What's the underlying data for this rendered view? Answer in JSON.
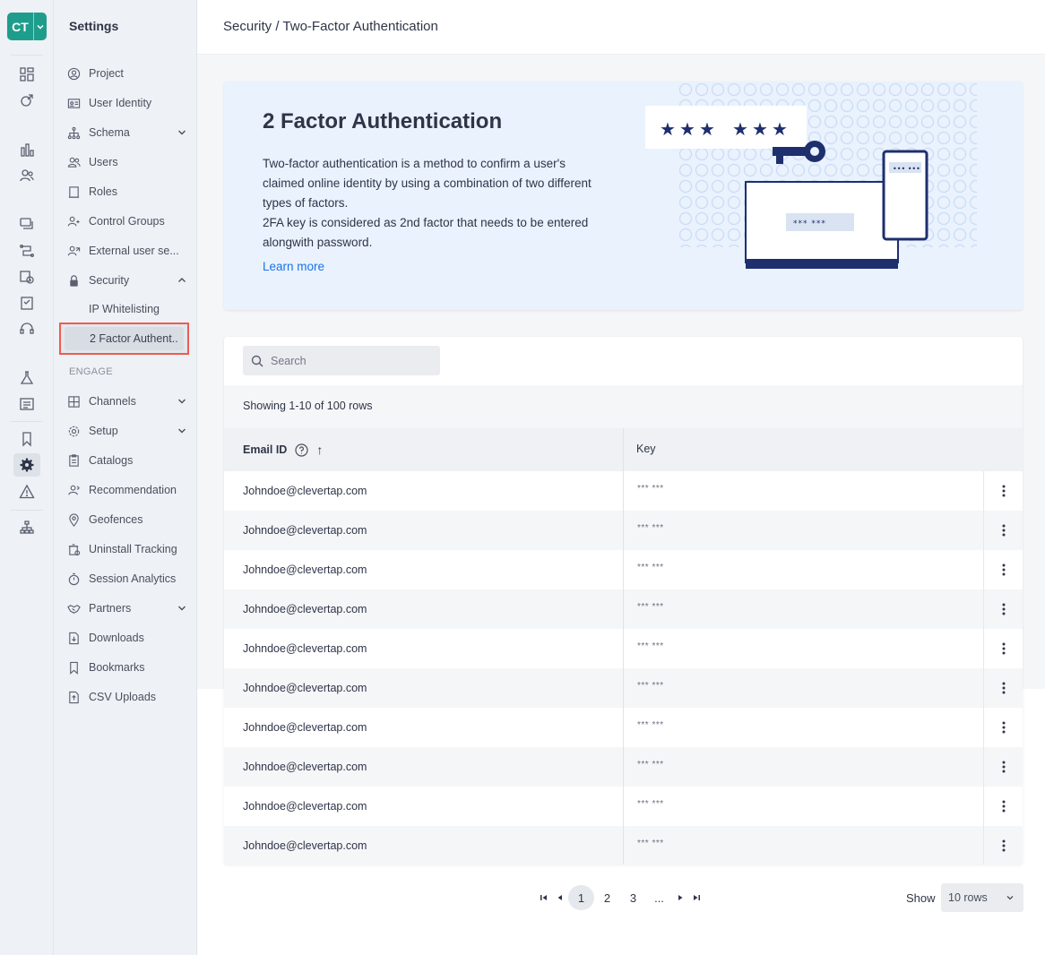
{
  "brand": {
    "logo_text": "CT"
  },
  "sidebar": {
    "title": "Settings",
    "items": [
      {
        "label": "Project",
        "icon": "project-icon"
      },
      {
        "label": "User Identity",
        "icon": "id-card-icon"
      },
      {
        "label": "Schema",
        "icon": "schema-icon",
        "expandable": true
      },
      {
        "label": "Users",
        "icon": "users-icon"
      },
      {
        "label": "Roles",
        "icon": "roles-icon"
      },
      {
        "label": "Control Groups",
        "icon": "control-groups-icon"
      },
      {
        "label": "External user se...",
        "icon": "external-users-icon"
      },
      {
        "label": "Security",
        "icon": "lock-icon",
        "expanded": true
      }
    ],
    "security_sub": [
      "IP Whitelisting",
      "2 Factor Authent.."
    ],
    "section_engage": "ENGAGE",
    "engage_items": [
      {
        "label": "Channels",
        "icon": "channels-icon",
        "expandable": true
      },
      {
        "label": "Setup",
        "icon": "gear-icon",
        "expandable": true
      },
      {
        "label": "Catalogs",
        "icon": "catalog-icon"
      },
      {
        "label": "Recommendation",
        "icon": "recommendation-icon"
      },
      {
        "label": "Geofences",
        "icon": "location-pin-icon"
      },
      {
        "label": "Uninstall Tracking",
        "icon": "uninstall-icon"
      },
      {
        "label": "Session Analytics",
        "icon": "stopwatch-icon"
      },
      {
        "label": "Partners",
        "icon": "handshake-icon",
        "expandable": true
      },
      {
        "label": "Downloads",
        "icon": "download-icon"
      },
      {
        "label": "Bookmarks",
        "icon": "bookmark-icon"
      },
      {
        "label": "CSV Uploads",
        "icon": "upload-icon"
      }
    ]
  },
  "header": {
    "breadcrumb": "Security / Two-Factor Authentication"
  },
  "banner": {
    "title": "2 Factor Authentication",
    "description_line1": "Two-factor authentication is a method to confirm a user's claimed online identity by using a combination of two different types of factors.",
    "description_line2": "2FA key is considered as 2nd factor that needs to be entered alongwith password.",
    "learn_more": "Learn more"
  },
  "table": {
    "search_placeholder": "Search",
    "showing_text": "Showing 1-10 of 100 rows",
    "columns": {
      "email": "Email ID",
      "key": "Key"
    },
    "sort_arrow": "↑",
    "rows": [
      {
        "email": "Johndoe@clevertap.com",
        "key": "*** ***"
      },
      {
        "email": "Johndoe@clevertap.com",
        "key": "*** ***"
      },
      {
        "email": "Johndoe@clevertap.com",
        "key": "*** ***"
      },
      {
        "email": "Johndoe@clevertap.com",
        "key": "*** ***"
      },
      {
        "email": "Johndoe@clevertap.com",
        "key": "*** ***"
      },
      {
        "email": "Johndoe@clevertap.com",
        "key": "*** ***"
      },
      {
        "email": "Johndoe@clevertap.com",
        "key": "*** ***"
      },
      {
        "email": "Johndoe@clevertap.com",
        "key": "*** ***"
      },
      {
        "email": "Johndoe@clevertap.com",
        "key": "*** ***"
      },
      {
        "email": "Johndoe@clevertap.com",
        "key": "*** ***"
      }
    ]
  },
  "pagination": {
    "pages": [
      "1",
      "2",
      "3",
      "..."
    ],
    "current": "1",
    "show_label": "Show",
    "rows_value": "10 rows"
  },
  "colors": {
    "brand": "#1f9d8c",
    "link": "#1a73e8",
    "highlight_border": "#ec5c4f",
    "illustration_navy": "#1e2f6e"
  }
}
